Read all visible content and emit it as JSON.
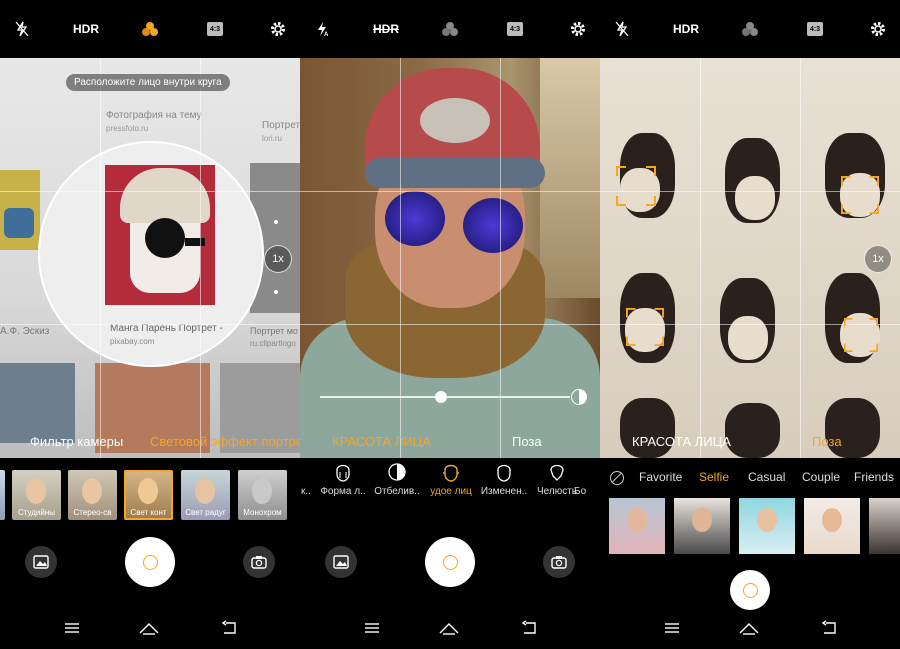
{
  "panels": [
    {
      "topbar": {
        "hdr": "HDR",
        "ratio": "4:3"
      },
      "hint": "Расположите лицо внутри круга",
      "zoom": "1x",
      "modes": [
        "Фильтр камеры",
        "Световой эффект портрета"
      ],
      "screen": {
        "caption1": "Фотография на тему",
        "caption1_source": "pressfoto.ru",
        "caption2": "Портрет",
        "caption2_source": "lori.ru",
        "caption3": "Манга Парень Портрет -",
        "caption3_source": "pixabay.com",
        "caption4": "Портрет мо",
        "caption4_source": "ru.clipartlogo",
        "caption5": "А.Ф. Эскиз"
      },
      "filters": [
        {
          "label": ""
        },
        {
          "label": "Студийны"
        },
        {
          "label": "Стерео-св"
        },
        {
          "label": "Свет конт"
        },
        {
          "label": "Свет радуг"
        },
        {
          "label": "Монохром"
        }
      ]
    },
    {
      "topbar": {
        "hdr": "HDR",
        "ratio": "4:3"
      },
      "modes": [
        "КРАСОТА ЛИЦА",
        "Поза"
      ],
      "tools": [
        "к..",
        "Форма л..",
        "Отбелив..",
        "удое лиц",
        "Изменен..",
        "Челюсть",
        "Бо"
      ]
    },
    {
      "topbar": {
        "hdr": "HDR",
        "ratio": "4:3"
      },
      "zoom": "1x",
      "modes": [
        "КРАСОТА ЛИЦА",
        "Поза"
      ],
      "filters": [
        "Favorite",
        "Selfie",
        "Casual",
        "Couple",
        "Friends"
      ]
    }
  ],
  "colors": {
    "accent": "#f5a623",
    "background": "#000000"
  }
}
